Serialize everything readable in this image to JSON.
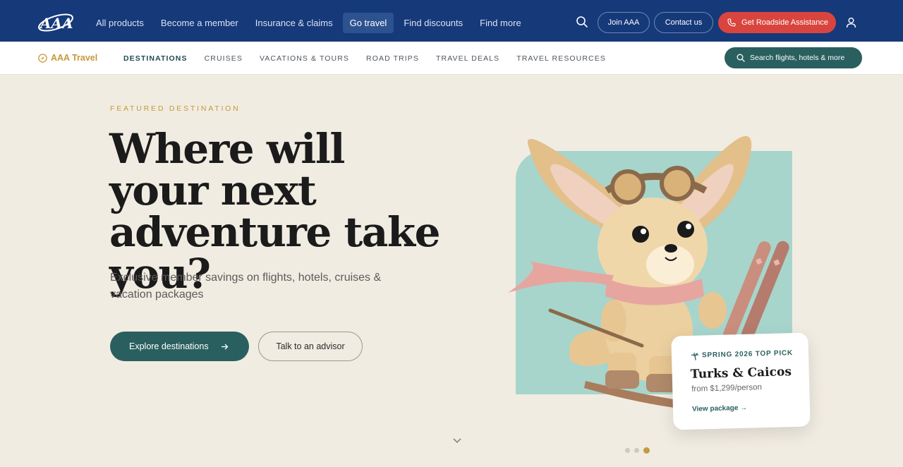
{
  "topnav": {
    "items": [
      {
        "label": "All products"
      },
      {
        "label": "Become a member"
      },
      {
        "label": "Insurance & claims"
      },
      {
        "label": "Go travel",
        "active": true
      },
      {
        "label": "Find discounts"
      },
      {
        "label": "Find more"
      }
    ],
    "join_label": "Join AAA",
    "contact_label": "Contact us",
    "roadside_label": "Get Roadside Assistance",
    "icons": [
      "aaa-logo",
      "search-icon",
      "phone-icon",
      "user-icon"
    ]
  },
  "subnav": {
    "brand": "AAA Travel",
    "items": [
      {
        "label": "DESTINATIONS",
        "active": true
      },
      {
        "label": "CRUISES"
      },
      {
        "label": "VACATIONS & TOURS"
      },
      {
        "label": "ROAD TRIPS"
      },
      {
        "label": "TRAVEL DEALS"
      },
      {
        "label": "TRAVEL RESOURCES"
      }
    ],
    "search_label": "Search flights, hotels & more"
  },
  "hero": {
    "eyebrow": "FEATURED DESTINATION",
    "headline": "Where will your next adventure take you?",
    "subtext": "Exclusive member savings on flights, hotels, cruises & vacation packages",
    "primary_cta": "Explore destinations",
    "secondary_cta": "Talk to an advisor"
  },
  "card": {
    "badge": "SPRING 2026 TOP PICK",
    "destination": "Turks & Caicos",
    "price": "from $1,299/person",
    "link": "View package"
  },
  "carousel": {
    "slide_count": 3,
    "active_index": 2
  },
  "colors": {
    "navy": "#16397a",
    "teal": "#2a5f5f",
    "gold": "#c49a3c",
    "red": "#d9453e",
    "cream": "#f1ece2"
  }
}
